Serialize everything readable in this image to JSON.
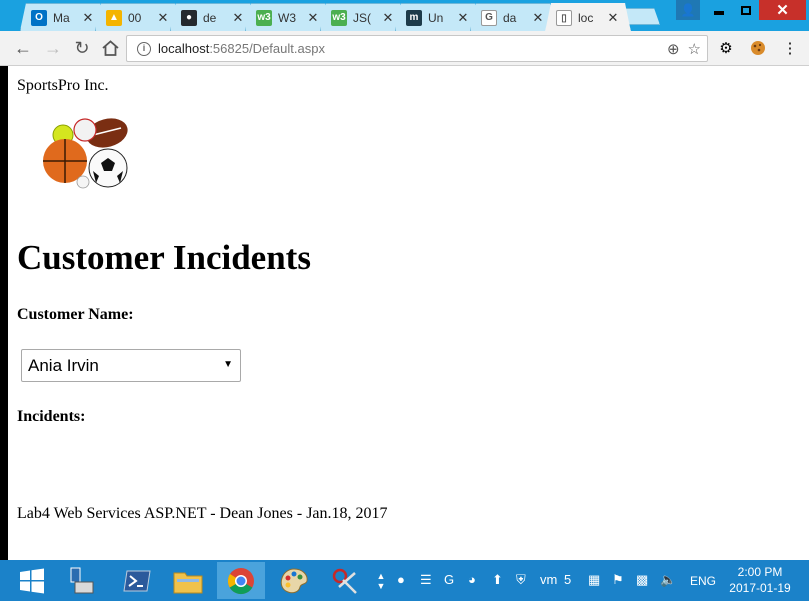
{
  "browser": {
    "tabs": [
      {
        "label": "Ma",
        "favicon": "outlook-icon",
        "color": "#0072c6",
        "glyph": "O"
      },
      {
        "label": "00",
        "favicon": "google-drive-icon",
        "color": "#f4b400",
        "glyph": "▲"
      },
      {
        "label": "de",
        "favicon": "github-icon",
        "color": "#24292e",
        "glyph": "●"
      },
      {
        "label": "W3",
        "favicon": "w3schools-icon",
        "color": "#4caf50",
        "glyph": "w3"
      },
      {
        "label": "JS(",
        "favicon": "w3schools-icon",
        "color": "#4caf50",
        "glyph": "w3"
      },
      {
        "label": "Un",
        "favicon": "m-icon",
        "color": "#1d3b4a",
        "glyph": "m"
      },
      {
        "label": "da",
        "favicon": "google-icon",
        "color": "#ffffff",
        "glyph": "G"
      },
      {
        "label": "loc",
        "favicon": "page-icon",
        "color": "#ffffff",
        "glyph": "▯"
      }
    ],
    "close_glyph": "✕",
    "address": {
      "host": "localhost",
      "path": ":56825/Default.aspx"
    }
  },
  "page": {
    "company": "SportsPro Inc.",
    "heading": "Customer Incidents",
    "customer_label": "Customer Name:",
    "customer_selected": "Ania Irvin",
    "incidents_label": "Incidents:",
    "footer": "Lab4 Web Services ASP.NET - Dean Jones - Jan.18, 2017"
  },
  "taskbar": {
    "lang": "ENG",
    "time": "2:00 PM",
    "date": "2017-01-19"
  },
  "colors": {
    "tabstrip": "#1aa1e0",
    "taskbar": "#1b82c9",
    "close_button": "#c7302a"
  }
}
